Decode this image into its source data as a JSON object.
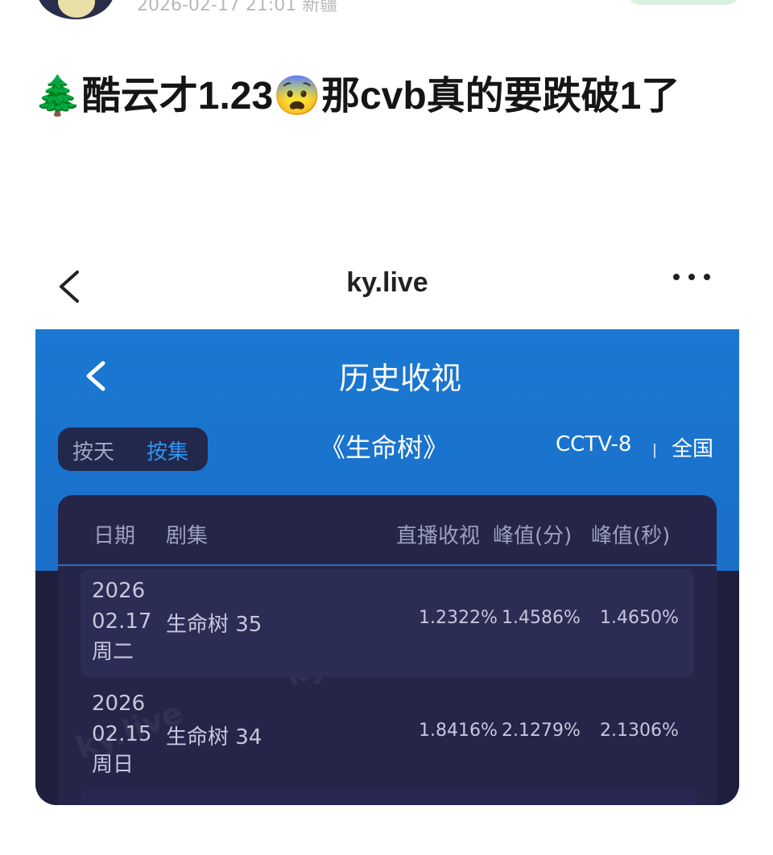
{
  "post": {
    "meta": "2026-02-17 21:01 新疆",
    "title": "🌲酷云才1.23😨那cvb真的要跌破1了"
  },
  "browser": {
    "url": "ky.live"
  },
  "app": {
    "title": "历史收视",
    "toggle": {
      "by_day": "按天",
      "by_episode": "按集"
    },
    "show": "《生命树》",
    "channel": "CCTV-8",
    "region": "全国",
    "watermark": "ky.live"
  },
  "table": {
    "headers": [
      "日期",
      "剧集",
      "直播收视",
      "峰值(分)",
      "峰值(秒)"
    ],
    "rows": [
      {
        "year": "2026",
        "date": "02.17",
        "weekday": "周二",
        "episode": "生命树 35",
        "live": "1.2322%",
        "peak_min": "1.4586%",
        "peak_sec": "1.4650%"
      },
      {
        "year": "2026",
        "date": "02.15",
        "weekday": "周日",
        "episode": "生命树 34",
        "live": "1.8416%",
        "peak_min": "2.1279%",
        "peak_sec": "2.1306%"
      }
    ]
  },
  "colors": {
    "accent_blue": "#1b6fc8",
    "table_bg": "#25254a",
    "toggle_active": "#2f97f2"
  }
}
